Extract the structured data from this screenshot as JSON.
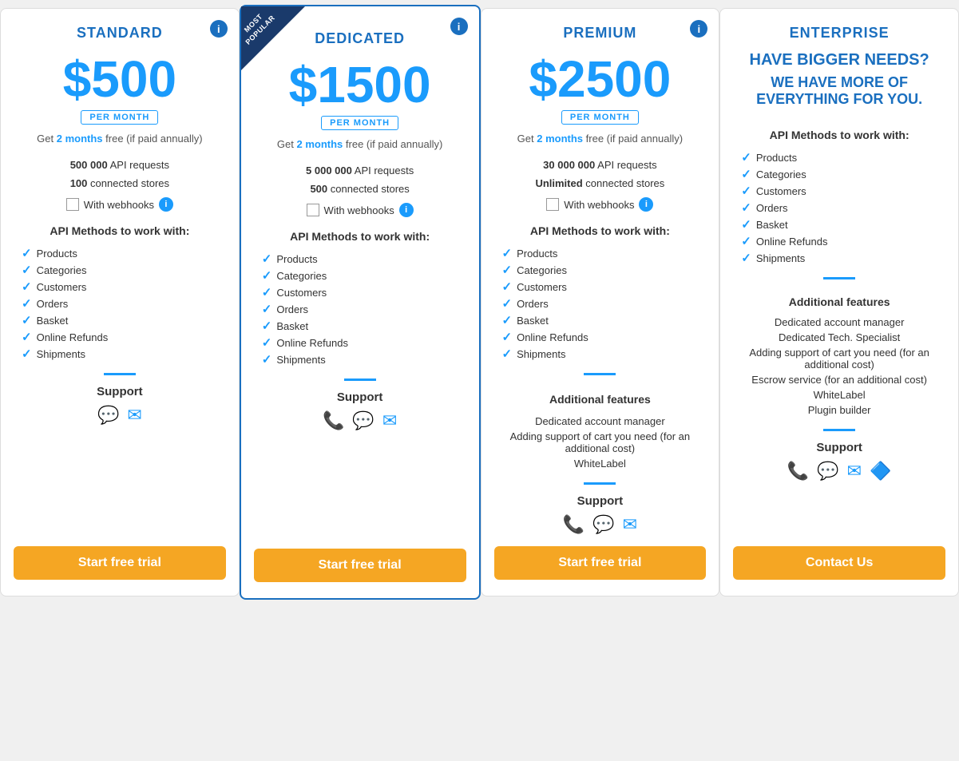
{
  "plans": {
    "standard": {
      "title": "STANDARD",
      "price": "$500",
      "period": "PER MONTH",
      "annual": "Get",
      "annual_highlight": "2 months",
      "annual_rest": "free (if paid annually)",
      "api_requests": "500 000",
      "api_requests_label": "API requests",
      "connected_stores": "100",
      "connected_stores_label": "connected stores",
      "webhooks_label": "With webhooks",
      "api_methods_title": "API Methods to work with:",
      "api_methods": [
        "Products",
        "Categories",
        "Customers",
        "Orders",
        "Basket",
        "Online Refunds",
        "Shipments"
      ],
      "support_title": "Support",
      "button_label": "Start free trial"
    },
    "dedicated": {
      "title": "DEDICATED",
      "badge": "MOST POPULAR",
      "price": "$1500",
      "period": "PER MONTH",
      "annual": "Get",
      "annual_highlight": "2 months",
      "annual_rest": "free (if paid annually)",
      "api_requests": "5 000 000",
      "api_requests_label": "API requests",
      "connected_stores": "500",
      "connected_stores_label": "connected stores",
      "webhooks_label": "With webhooks",
      "api_methods_title": "API Methods to work with:",
      "api_methods": [
        "Products",
        "Categories",
        "Customers",
        "Orders",
        "Basket",
        "Online Refunds",
        "Shipments"
      ],
      "support_title": "Support",
      "button_label": "Start free trial"
    },
    "premium": {
      "title": "PREMIUM",
      "price": "$2500",
      "period": "PER MONTH",
      "annual": "Get",
      "annual_highlight": "2 months",
      "annual_rest": "free (if paid annually)",
      "api_requests": "30 000 000",
      "api_requests_label": "API requests",
      "connected_stores": "Unlimited",
      "connected_stores_label": "connected stores",
      "webhooks_label": "With webhooks",
      "api_methods_title": "API Methods to work with:",
      "api_methods": [
        "Products",
        "Categories",
        "Customers",
        "Orders",
        "Basket",
        "Online Refunds",
        "Shipments"
      ],
      "additional_title": "Additional features",
      "additional_features": [
        "Dedicated account manager",
        "Adding support of cart you need (for an additional cost)",
        "WhiteLabel"
      ],
      "support_title": "Support",
      "button_label": "Start free trial"
    },
    "enterprise": {
      "title": "ENTERPRISE",
      "header1": "HAVE BIGGER NEEDS?",
      "header2": "WE HAVE MORE OF EVERYTHING FOR YOU.",
      "api_methods_title": "API Methods to work with:",
      "api_methods": [
        "Products",
        "Categories",
        "Customers",
        "Orders",
        "Basket",
        "Online Refunds",
        "Shipments"
      ],
      "additional_title": "Additional features",
      "additional_features": [
        "Dedicated account manager",
        "Dedicated Tech. Specialist",
        "Adding support of cart you need (for an additional cost)",
        "Escrow service (for an additional cost)",
        "WhiteLabel",
        "Plugin builder"
      ],
      "support_title": "Support",
      "button_label": "Contact Us"
    }
  },
  "icons": {
    "chat": "💬",
    "email": "✉",
    "phone": "📞",
    "slack": "🔷",
    "info": "i",
    "check": "✓"
  }
}
